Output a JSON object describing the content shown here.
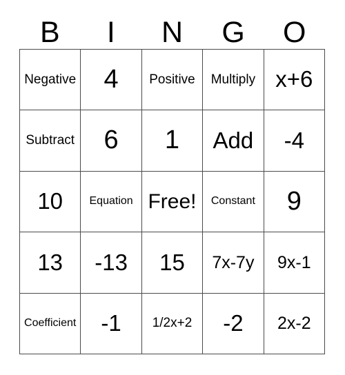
{
  "card": {
    "title": "Bingo Card",
    "header_letters": [
      "B",
      "I",
      "N",
      "G",
      "O"
    ],
    "colors": {
      "text": "#000000",
      "background": "#ffffff",
      "grid_line": "#4a4a4a"
    },
    "grid": {
      "rows": 5,
      "columns": 5,
      "free_space": {
        "row": 3,
        "column": 3,
        "label": "Free!"
      }
    },
    "cells": [
      [
        {
          "text": "Negative",
          "size": "fs-sm"
        },
        {
          "text": "4",
          "size": "fs-xxl"
        },
        {
          "text": "Positive",
          "size": "fs-sm"
        },
        {
          "text": "Multiply",
          "size": "fs-sm"
        },
        {
          "text": "x+6",
          "size": "fs-xl"
        }
      ],
      [
        {
          "text": "Subtract",
          "size": "fs-sm"
        },
        {
          "text": "6",
          "size": "fs-xxl"
        },
        {
          "text": "1",
          "size": "fs-xxl"
        },
        {
          "text": "Add",
          "size": "fs-xl"
        },
        {
          "text": "-4",
          "size": "fs-xl"
        }
      ],
      [
        {
          "text": "10",
          "size": "fs-xl"
        },
        {
          "text": "Equation",
          "size": "fs-xs"
        },
        {
          "text": "Free!",
          "size": "fs-lg"
        },
        {
          "text": "Constant",
          "size": "fs-xs"
        },
        {
          "text": "9",
          "size": "fs-xxl"
        }
      ],
      [
        {
          "text": "13",
          "size": "fs-xl"
        },
        {
          "text": "-13",
          "size": "fs-xl"
        },
        {
          "text": "15",
          "size": "fs-xl"
        },
        {
          "text": "7x-7y",
          "size": "fs-md"
        },
        {
          "text": "9x-1",
          "size": "fs-md"
        }
      ],
      [
        {
          "text": "Coefficient",
          "size": "fs-xs"
        },
        {
          "text": "-1",
          "size": "fs-xl"
        },
        {
          "text": "1/2x+2",
          "size": "fs-sm"
        },
        {
          "text": "-2",
          "size": "fs-xl"
        },
        {
          "text": "2x-2",
          "size": "fs-md"
        }
      ]
    ]
  }
}
